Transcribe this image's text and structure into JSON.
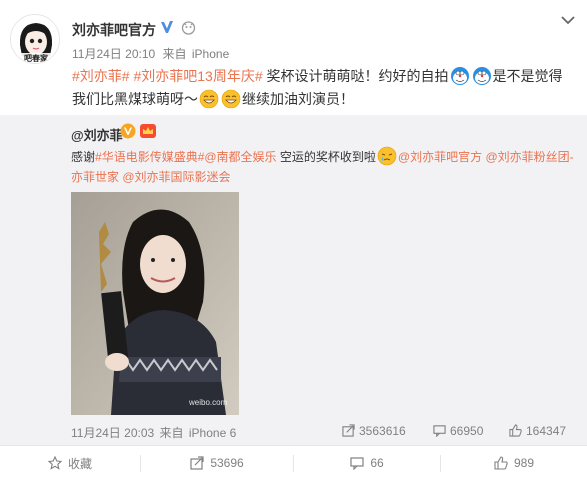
{
  "post": {
    "author": "刘亦菲吧官方",
    "time": "11月24日 20:10",
    "source_prefix": "来自",
    "source": "iPhone",
    "avatar_caption": "吧春家",
    "text": {
      "tag1": "#刘亦菲#",
      "tag2": "#刘亦菲吧13周年庆#",
      "part1": " 奖杯设计萌萌哒！约好的自拍",
      "part2": "是不是觉得我们比黑煤球萌呀～",
      "part3": "继续加油刘演员！"
    }
  },
  "retweet": {
    "author": "@刘亦菲",
    "text": {
      "pre": "感谢",
      "tag1": "#华语电影传媒盛典#",
      "tag2": "@南都全娱乐",
      "mid": " 空运的奖杯收到啦",
      "m1": "@刘亦菲吧官方",
      "m2": "@刘亦菲粉丝团-亦菲世家",
      "m3": "@刘亦菲国际影迷会"
    },
    "watermark": "weibo.com",
    "time": "11月24日 20:03",
    "source_prefix": "来自",
    "source": "iPhone 6",
    "reposts": "3563616",
    "comments": "66950",
    "likes": "164347"
  },
  "actions": {
    "favorite": "收藏",
    "repost": "53696",
    "comment": "66",
    "like": "989"
  },
  "colors": {
    "link": "#eb7350",
    "meta": "#808080",
    "retweet_bg": "#f2f2f5",
    "verified": "#f6a623"
  },
  "icons": [
    "chevron-down-icon",
    "verified-icon",
    "member-icon",
    "emoji-doraemon-icon",
    "emoji-grin-icon",
    "emoji-tear-icon",
    "crown-icon",
    "repost-icon",
    "comment-icon",
    "like-icon",
    "star-icon"
  ]
}
